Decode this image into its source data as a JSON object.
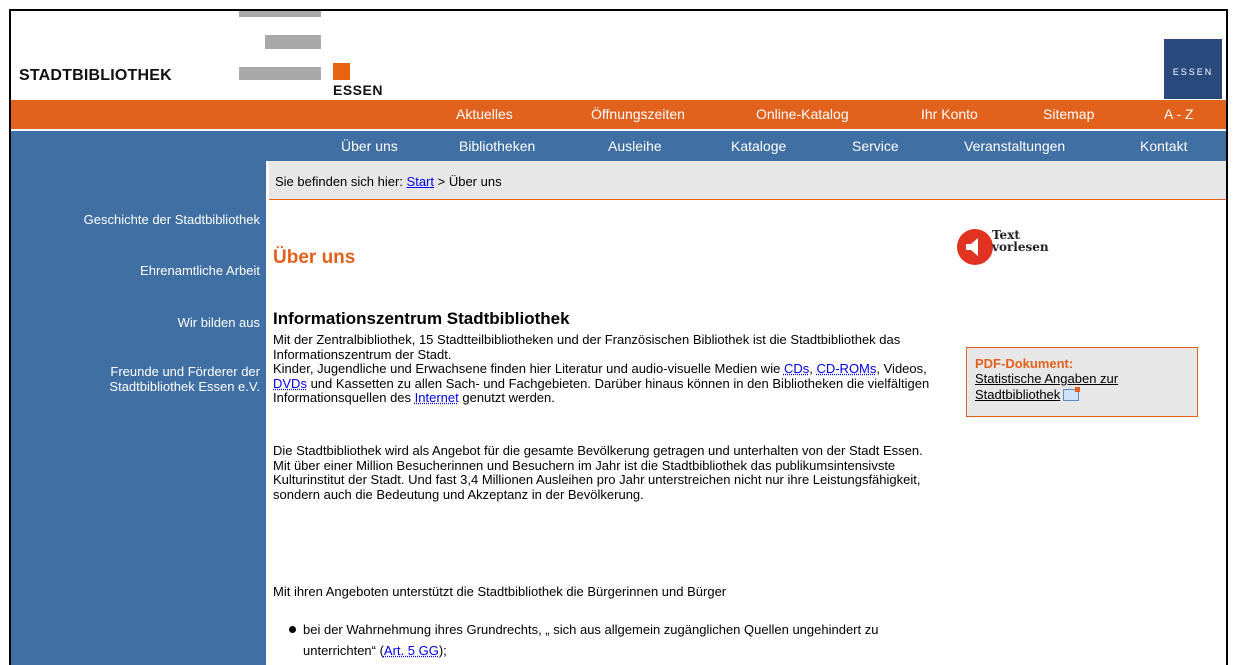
{
  "header": {
    "logo_text": "STADTBIBLIOTHEK",
    "logo_city": "ESSEN",
    "badge_text": "ESSEN"
  },
  "top_nav": {
    "items": [
      {
        "label": "Aktuelles"
      },
      {
        "label": "Öffnungszeiten"
      },
      {
        "label": "Online-Katalog"
      },
      {
        "label": "Ihr Konto"
      },
      {
        "label": "Sitemap"
      },
      {
        "label": "A - Z"
      }
    ]
  },
  "main_nav": {
    "items": [
      {
        "label": "Über uns"
      },
      {
        "label": "Bibliotheken"
      },
      {
        "label": "Ausleihe"
      },
      {
        "label": "Kataloge"
      },
      {
        "label": "Service"
      },
      {
        "label": "Veranstaltungen"
      },
      {
        "label": "Kontakt"
      }
    ]
  },
  "sidebar": {
    "items": [
      {
        "label": "Geschichte der Stadtbibliothek"
      },
      {
        "label": "Ehrenamtliche Arbeit"
      },
      {
        "label": "Wir bilden aus"
      },
      {
        "label_line1": "Freunde und Förderer der",
        "label_line2": "Stadtbibliothek Essen e.V."
      }
    ]
  },
  "breadcrumb": {
    "prefix": "Sie befinden sich hier: ",
    "start": "Start",
    "separator": " > ",
    "current": "Über uns"
  },
  "page": {
    "title": "Über uns",
    "section_title": "Informationszentrum Stadtbibliothek",
    "p1_a": "Mit der Zentralbibliothek, 15 Stadtteilbibliotheken und der Französischen Bibliothek ist die Stadtbibliothek das Informationszentrum der Stadt.",
    "p1_b": "Kinder, Jugendliche und Erwachsene finden hier Literatur und audio-visuelle Medien wie ",
    "link_cds": "CDs",
    "p1_c": ", ",
    "link_cdroms": "CD-ROMs",
    "p1_d": ", Videos, ",
    "link_dvds": "DVDs",
    "p1_e": " und Kassetten zu allen Sach- und Fachgebieten. Darüber hinaus können in den Bibliotheken die vielfältigen Informationsquellen des ",
    "link_internet": "Internet",
    "p1_f": " genutzt werden.",
    "p2_a": "Die Stadtbibliothek wird als Angebot für die gesamte Bevölkerung getragen und unterhalten von der Stadt Essen.",
    "p2_b": "Mit über einer Million Besucherinnen und Besuchern im Jahr ist die Stadtbibliothek das publikumsintensivste Kulturinstitut der Stadt. Und fast 3,4 Millionen Ausleihen pro Jahr unterstreichen nicht nur ihre Leistungsfähigkeit, sondern auch die Bedeutung und Akzeptanz in der Bevölkerung.",
    "p3": "Mit ihren Angeboten unterstützt die Stadtbibliothek die Bürgerinnen und Bürger",
    "bullet_a": "bei der Wahrnehmung ihres Grundrechts, „ sich aus allgemein zugänglichen Quellen ungehindert zu unterrichten“ (",
    "bullet_link": "Art. 5 GG",
    "bullet_b": ");"
  },
  "read_aloud": {
    "line1": "Text",
    "line2": "vorlesen"
  },
  "pdf_box": {
    "title": "PDF-Dokument:",
    "link": "Statistische Angaben zur Stadtbibliothek"
  },
  "colors": {
    "orange": "#e2611c",
    "blue": "#3f6fa3",
    "navy": "#2a4a7d",
    "grey_bg": "#e7e7e7"
  }
}
